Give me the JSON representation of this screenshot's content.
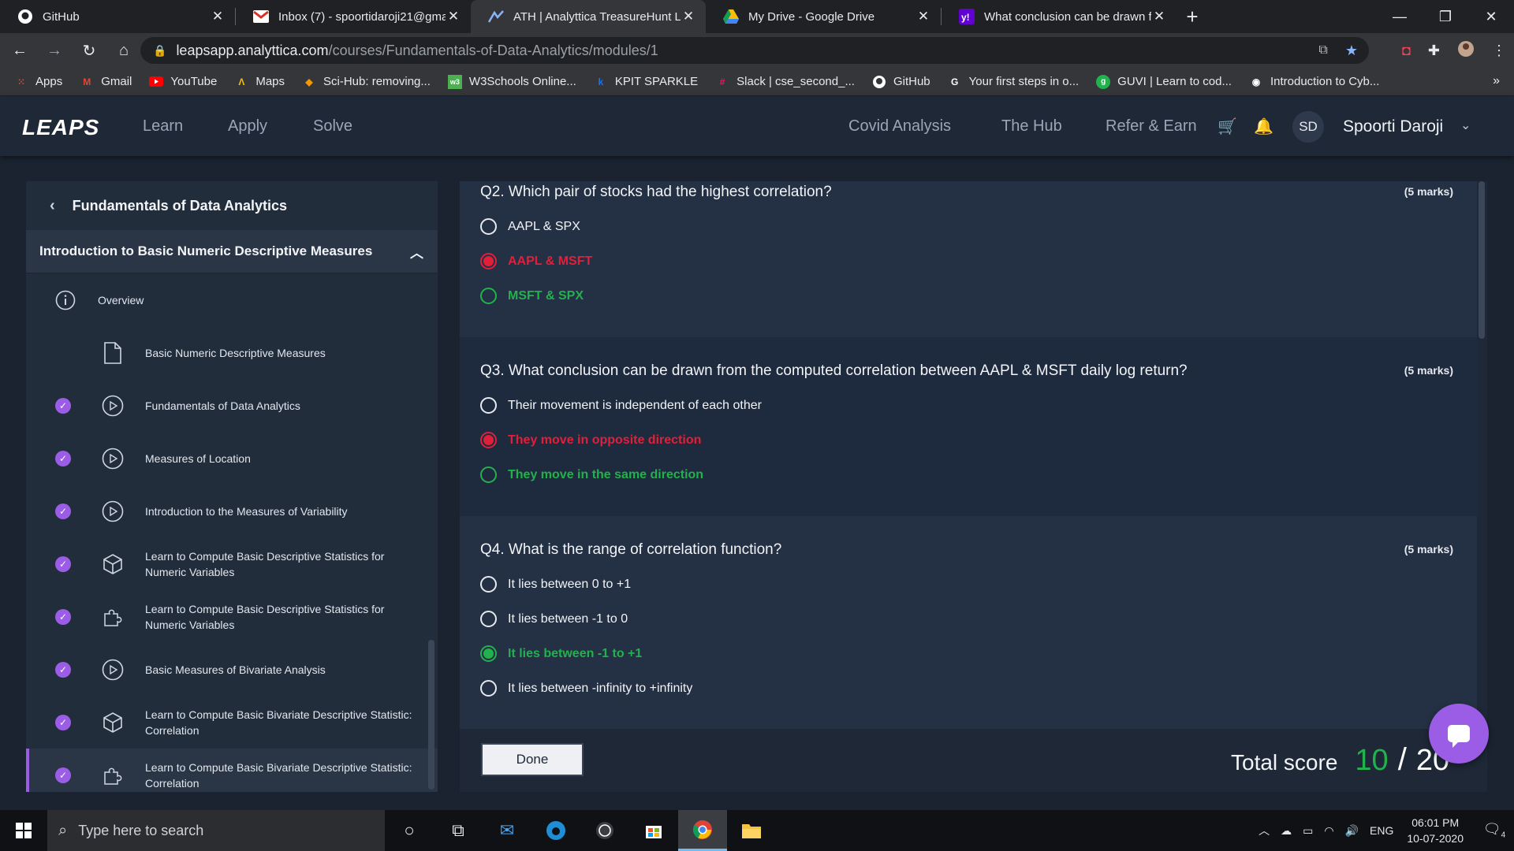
{
  "browser": {
    "tabs": [
      {
        "title": "GitHub"
      },
      {
        "title": "Inbox (7) - spoortidaroji21@gma"
      },
      {
        "title": "ATH | Analyttica TreasureHunt Le"
      },
      {
        "title": "My Drive - Google Drive"
      },
      {
        "title": "What conclusion can be drawn fr"
      }
    ],
    "url_host": "leapsapp.analyttica.com",
    "url_path": "/courses/Fundamentals-of-Data-Analytics/modules/1",
    "bookmarks": [
      {
        "label": "Apps"
      },
      {
        "label": "Gmail"
      },
      {
        "label": "YouTube"
      },
      {
        "label": "Maps"
      },
      {
        "label": "Sci-Hub: removing..."
      },
      {
        "label": "W3Schools Online..."
      },
      {
        "label": "KPIT SPARKLE"
      },
      {
        "label": "Slack | cse_second_..."
      },
      {
        "label": "GitHub"
      },
      {
        "label": "Your first steps in o..."
      },
      {
        "label": "GUVI | Learn to cod..."
      },
      {
        "label": "Introduction to Cyb..."
      }
    ],
    "bookmarks_more": "»"
  },
  "app_nav": {
    "logo": "LEAPS",
    "left_links": [
      "Learn",
      "Apply",
      "Solve"
    ],
    "right_links": [
      "Covid Analysis",
      "The Hub",
      "Refer & Earn"
    ],
    "avatar_initials": "SD",
    "user_name": "Spoorti Daroji"
  },
  "sidebar": {
    "course_title": "Fundamentals of Data Analytics",
    "module_title": "Introduction to Basic Numeric Descriptive Measures",
    "overview_label": "Overview",
    "items": [
      {
        "label": "Basic Numeric Descriptive Measures",
        "icon": "document-icon",
        "done": false
      },
      {
        "label": "Fundamentals of Data Analytics",
        "icon": "play-icon",
        "done": true
      },
      {
        "label": "Measures of Location",
        "icon": "play-icon",
        "done": true
      },
      {
        "label": "Introduction to the Measures of Variability",
        "icon": "play-icon",
        "done": true
      },
      {
        "label": "Learn to Compute Basic Descriptive Statistics for Numeric Variables",
        "icon": "cube-icon",
        "done": true
      },
      {
        "label": "Learn to Compute Basic Descriptive Statistics for Numeric Variables",
        "icon": "puzzle-icon",
        "done": true
      },
      {
        "label": "Basic Measures of Bivariate Analysis",
        "icon": "play-icon",
        "done": true
      },
      {
        "label": "Learn to Compute Basic Bivariate Descriptive Statistic: Correlation",
        "icon": "cube-icon",
        "done": true
      },
      {
        "label": "Learn to Compute Basic Bivariate Descriptive Statistic: Correlation",
        "icon": "puzzle-icon",
        "done": true,
        "active": true
      }
    ]
  },
  "quiz": {
    "questions": [
      {
        "title": "Q2. Which pair of stocks had the highest correlation?",
        "marks": "(5 marks)",
        "options": [
          {
            "text": "AAPL & SPX",
            "state": "neutral"
          },
          {
            "text": "AAPL & MSFT",
            "state": "wrong-selected"
          },
          {
            "text": "MSFT & SPX",
            "state": "correct"
          }
        ]
      },
      {
        "title": "Q3. What conclusion can be drawn from the computed correlation between AAPL & MSFT daily log return?",
        "marks": "(5 marks)",
        "options": [
          {
            "text": "Their movement is independent of each other",
            "state": "neutral"
          },
          {
            "text": "They move in opposite direction",
            "state": "wrong-selected"
          },
          {
            "text": "They move in the same direction",
            "state": "correct"
          }
        ]
      },
      {
        "title": "Q4. What is the range of correlation function?",
        "marks": "(5 marks)",
        "options": [
          {
            "text": "It lies between 0 to +1",
            "state": "neutral"
          },
          {
            "text": "It lies between -1 to 0",
            "state": "neutral"
          },
          {
            "text": "It lies between -1 to +1",
            "state": "correct-selected"
          },
          {
            "text": "It lies between -infinity to +infinity",
            "state": "neutral"
          }
        ]
      }
    ],
    "done_label": "Done",
    "total_label": "Total score",
    "score": "10",
    "separator": "/",
    "max_score": "20"
  },
  "taskbar": {
    "search_placeholder": "Type here to search",
    "language": "ENG",
    "time": "06:01 PM",
    "date": "10-07-2020",
    "notifications": "4"
  },
  "colors": {
    "accent_purple": "#9b5de5",
    "correct_green": "#22b14c",
    "wrong_red": "#e0203a"
  }
}
